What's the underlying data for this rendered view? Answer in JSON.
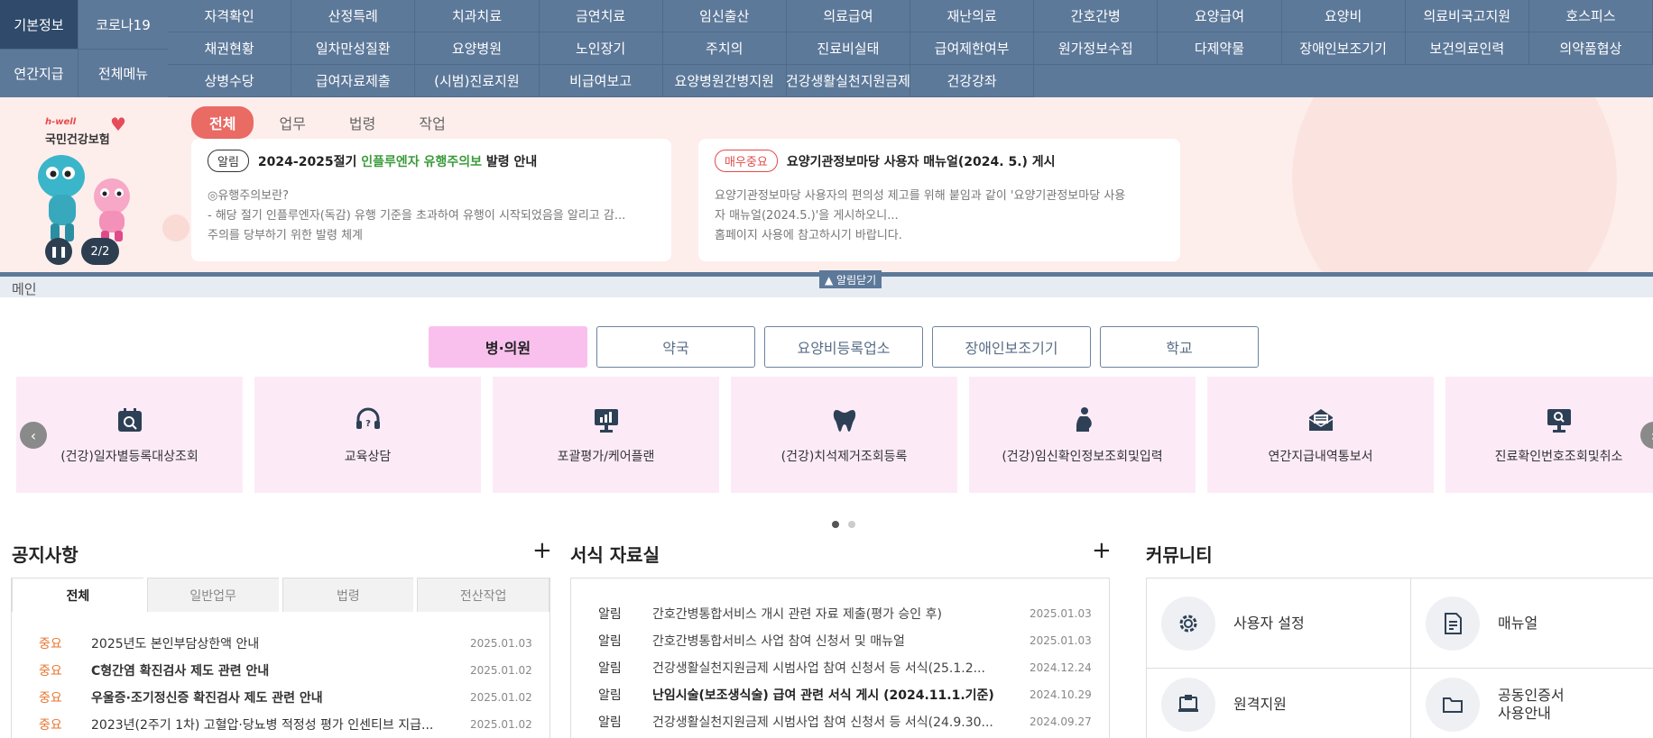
{
  "left_menu": {
    "basic": "기본정보",
    "covid": "코로나19",
    "annual": "연간지급",
    "all_menu": "전체메뉴"
  },
  "nav": [
    "자격확인",
    "산정특례",
    "치과치료",
    "금연치료",
    "임신출산",
    "의료급여",
    "재난의료",
    "간호간병",
    "요양급여",
    "요양비",
    "의료비국고지원",
    "호스피스",
    "채권현황",
    "일차만성질환",
    "요양병원",
    "노인장기",
    "주치의",
    "진료비실태",
    "급여제한여부",
    "원가정보수집",
    "다제약물",
    "장애인보조기기",
    "보건의료인력",
    "의약품협상",
    "상병수당",
    "급여자료제출",
    "(시범)진료지원",
    "비급여보고",
    "요양병원간병지원",
    "건강생활실천지원금제",
    "건강강좌"
  ],
  "banner": {
    "logo_sub": "h-well",
    "logo_main": "국민건강보험",
    "tabs": [
      "전체",
      "업무",
      "법령",
      "작업"
    ],
    "counter": "2/2",
    "card1": {
      "tag": "알림",
      "title_pre": "2024-2025절기 ",
      "title_hl": "인플루엔자 유행주의보",
      "title_post": " 발령 안내",
      "lines": [
        "◎유행주의보란?",
        "- 해당 절기 인플루엔자(독감) 유행 기준을 초과하여 유행이 시작되었음을 알리고 감...",
        "주의를 당부하기 위한 발령 체계"
      ]
    },
    "card2": {
      "tag": "매우중요",
      "title": "요양기관정보마당 사용자 매뉴얼(2024. 5.) 게시",
      "lines": [
        "요양기관정보마당 사용자의 편의성 제고를 위해 붙임과 같이 '요양기관정보마당 사용",
        "자 매뉴얼(2024.5.)'을 게시하오니...",
        "홈페이지 사용에 참고하시기 바랍니다."
      ]
    }
  },
  "main_bar": {
    "label": "메인",
    "close": "▲ 알림닫기"
  },
  "category_tabs": [
    "병·의원",
    "약국",
    "요양비등록업소",
    "장애인보조기기",
    "학교"
  ],
  "quick_links": [
    {
      "label": "(건강)일자별등록대상조회",
      "icon": "calendar-search-icon"
    },
    {
      "label": "교육상담",
      "icon": "headset-icon"
    },
    {
      "label": "포괄평가/케어플랜",
      "icon": "presentation-chart-icon"
    },
    {
      "label": "(건강)치석제거조회등록",
      "icon": "tooth-icon"
    },
    {
      "label": "(건강)임신확인정보조회및입력",
      "icon": "pregnant-icon"
    },
    {
      "label": "연간지급내역통보서",
      "icon": "envelope-icon"
    },
    {
      "label": "진료확인번호조회및취소",
      "icon": "monitor-search-icon"
    }
  ],
  "notice": {
    "title": "공지사항",
    "tabs": [
      "전체",
      "일반업무",
      "법령",
      "전산작업"
    ],
    "rows": [
      {
        "tag": "중요",
        "text": "2025년도 본인부담상한액 안내",
        "date": "2025.01.03",
        "bold": false
      },
      {
        "tag": "중요",
        "text": "C형간염 확진검사 제도 관련 안내",
        "date": "2025.01.02",
        "bold": true
      },
      {
        "tag": "중요",
        "text": "우울증·조기정신증 확진검사 제도 관련 안내",
        "date": "2025.01.02",
        "bold": true
      },
      {
        "tag": "중요",
        "text": "2023년(2주기 1차) 고혈압·당뇨병 적정성 평가 인센티브 지급...",
        "date": "2025.01.02",
        "bold": false
      }
    ]
  },
  "forms": {
    "title": "서식 자료실",
    "rows": [
      {
        "cat": "알림",
        "text": "간호간병통합서비스 개시 관련 자료 제출(평가 승인 후)",
        "date": "2025.01.03",
        "bold": false
      },
      {
        "cat": "알림",
        "text": "간호간병통합서비스 사업 참여 신청서 및 매뉴얼",
        "date": "2025.01.03",
        "bold": false
      },
      {
        "cat": "알림",
        "text": "건강생활실천지원금제 시범사업 참여 신청서 등 서식(25.1.2...",
        "date": "2024.12.24",
        "bold": false
      },
      {
        "cat": "알림",
        "text": "난임시술(보조생식술) 급여 관련 서식 게시 (2024.11.1.기준)",
        "date": "2024.10.29",
        "bold": true
      },
      {
        "cat": "알림",
        "text": "건강생활실천지원금제 시범사업 참여 신청서 등 서식(24.9.30...",
        "date": "2024.09.27",
        "bold": false
      }
    ]
  },
  "community": {
    "title": "커뮤니티",
    "items": [
      {
        "label": "사용자 설정",
        "icon": "gear-icon"
      },
      {
        "label": "매뉴얼",
        "icon": "document-icon"
      },
      {
        "label": "원격지원",
        "icon": "remote-support-icon"
      },
      {
        "label": "공동인증서\n사용안내",
        "label_l1": "공동인증서",
        "label_l2": "사용안내",
        "icon": "folder-icon"
      }
    ]
  },
  "colors": {
    "nav_bg": "#5d7999",
    "nav_active": "#2f4a6b",
    "banner_bg": "#fdeeec",
    "tab_active": "#ea6a64",
    "category_active": "#f9c0ee",
    "quick_card_bg": "#fcebf7",
    "important": "#e8762f"
  }
}
